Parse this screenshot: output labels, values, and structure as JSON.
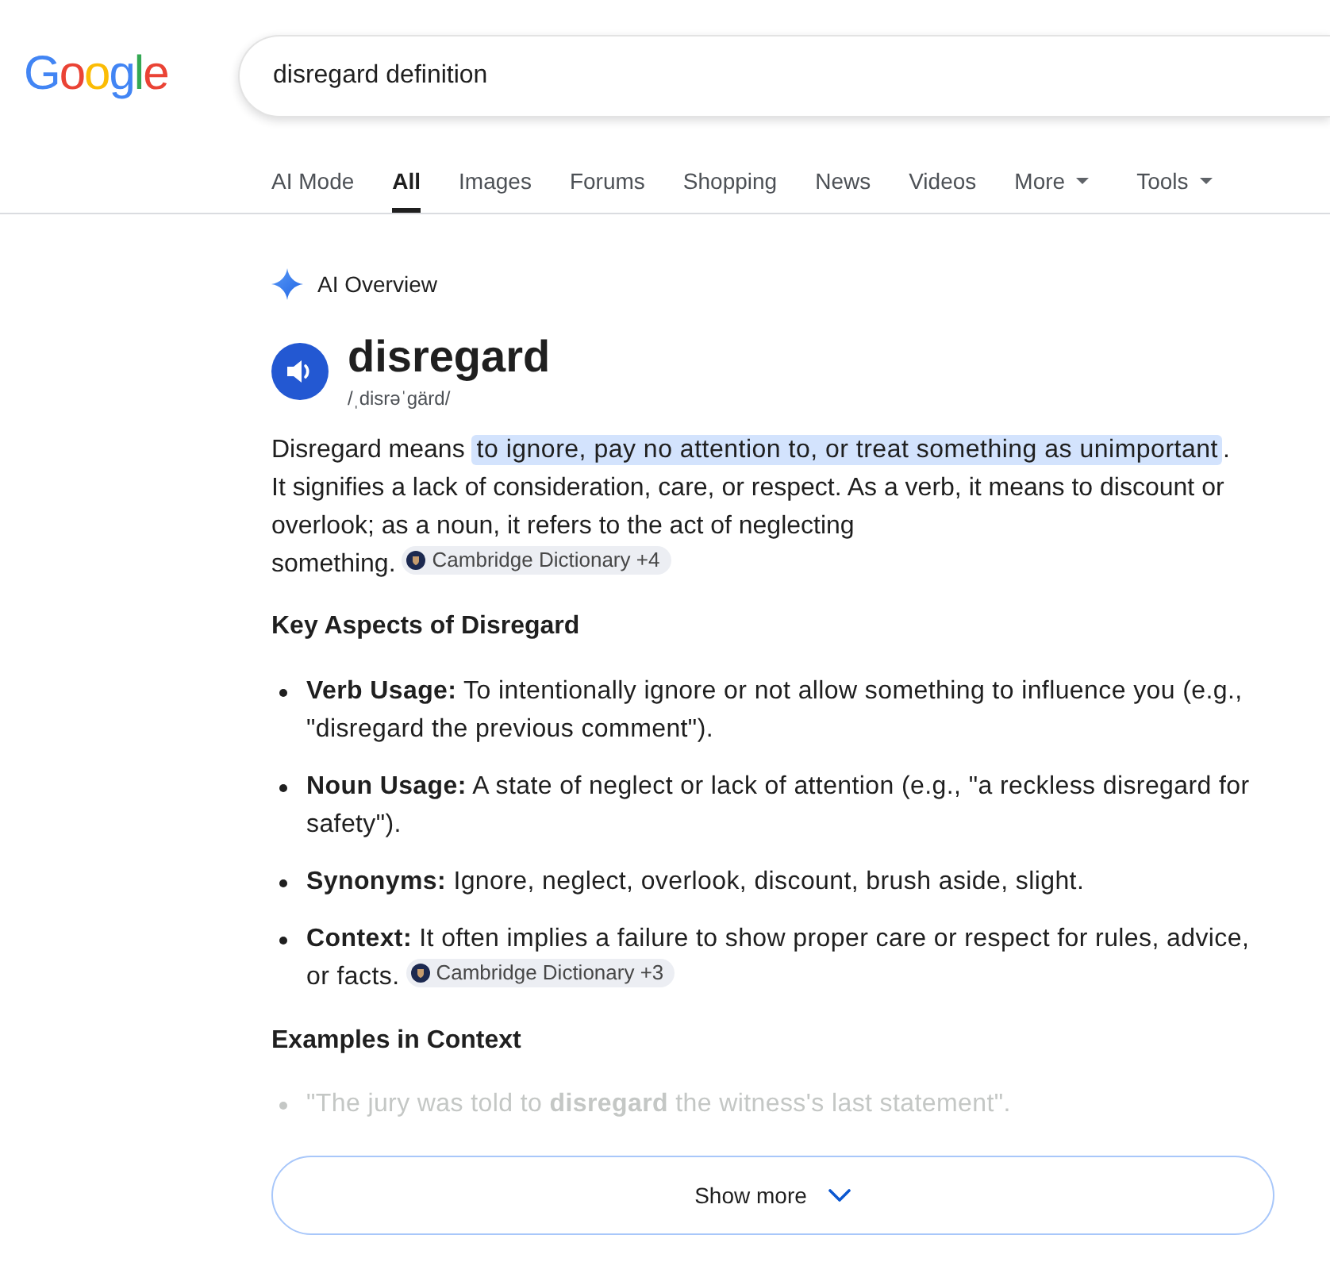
{
  "logo": {
    "text": "Google"
  },
  "search": {
    "value": "disregard definition"
  },
  "tabs": [
    {
      "label": "AI Mode",
      "selected": false,
      "kind": "tab"
    },
    {
      "label": "All",
      "selected": true,
      "kind": "tab"
    },
    {
      "label": "Images",
      "selected": false,
      "kind": "tab"
    },
    {
      "label": "Forums",
      "selected": false,
      "kind": "tab"
    },
    {
      "label": "Shopping",
      "selected": false,
      "kind": "tab"
    },
    {
      "label": "News",
      "selected": false,
      "kind": "tab"
    },
    {
      "label": "Videos",
      "selected": false,
      "kind": "tab"
    },
    {
      "label": "More",
      "selected": false,
      "kind": "menu"
    }
  ],
  "tools": {
    "label": "Tools",
    "kind": "menu"
  },
  "ai_overview": {
    "label": "AI Overview",
    "entry": {
      "word": "disregard",
      "phonetic": "/ˌdisrəˈgärd/"
    },
    "summary": {
      "lead": "Disregard means ",
      "highlight": "to ignore, pay no attention to, or treat something as unimportant",
      "rest": ". It signifies a lack of consideration, care, or respect. As a verb, it means to discount or overlook; as a noun, it refers to the act of neglecting something.",
      "source": "Cambridge Dictionary +4"
    },
    "key_aspects": {
      "heading": "Key Aspects of Disregard",
      "items": [
        {
          "text": "**Verb Usage:** To intentionally ignore or not allow something to influence you (e.g., \"disregard the previous comment\")."
        },
        {
          "text": "**Noun Usage:** A state of neglect or lack of attention (e.g., \"a reckless disregard for safety\")."
        },
        {
          "text": "**Synonyms:** Ignore, neglect, overlook, discount, brush aside, slight."
        },
        {
          "text": "**Context:** It often implies a failure to show proper care or respect for rules, advice, or facts.",
          "source": "Cambridge Dictionary +3"
        }
      ]
    },
    "examples": {
      "heading": "Examples in Context",
      "items": [
        {
          "text": "\"The jury was told to **disregard** the witness's last statement\".",
          "faded": true
        }
      ]
    },
    "show_more": {
      "label": "Show more"
    }
  }
}
